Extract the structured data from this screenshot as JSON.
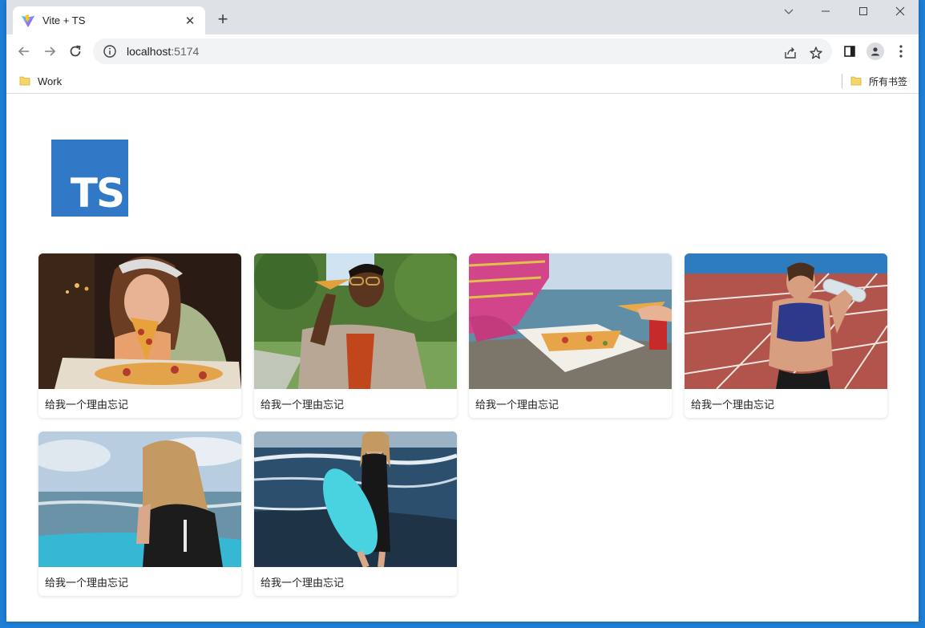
{
  "browser": {
    "tab": {
      "title": "Vite + TS"
    },
    "new_tab_label": "+",
    "address": {
      "host": "localhost",
      "port": ":5174"
    },
    "bookmarks": [
      {
        "label": "Work"
      },
      {
        "label": "所有书签"
      }
    ]
  },
  "page": {
    "logo_text": "TS",
    "cards": [
      {
        "caption": "给我一个理由忘记",
        "image": "woman-eating-pizza"
      },
      {
        "caption": "给我一个理由忘记",
        "image": "man-eating-pizza-outdoors"
      },
      {
        "caption": "给我一个理由忘记",
        "image": "pizza-box-by-sea"
      },
      {
        "caption": "给我一个理由忘记",
        "image": "woman-drinking-on-track"
      },
      {
        "caption": "给我一个理由忘记",
        "image": "woman-with-surfboard-back"
      },
      {
        "caption": "给我一个理由忘记",
        "image": "woman-with-surfboard-beach"
      }
    ]
  },
  "colors": {
    "desktop": "#1e7fd6",
    "tabstrip": "#dee1e6",
    "ts_blue": "#3178c6",
    "vite_purple": "#bd34fe",
    "vite_yellow": "#ffc517"
  }
}
